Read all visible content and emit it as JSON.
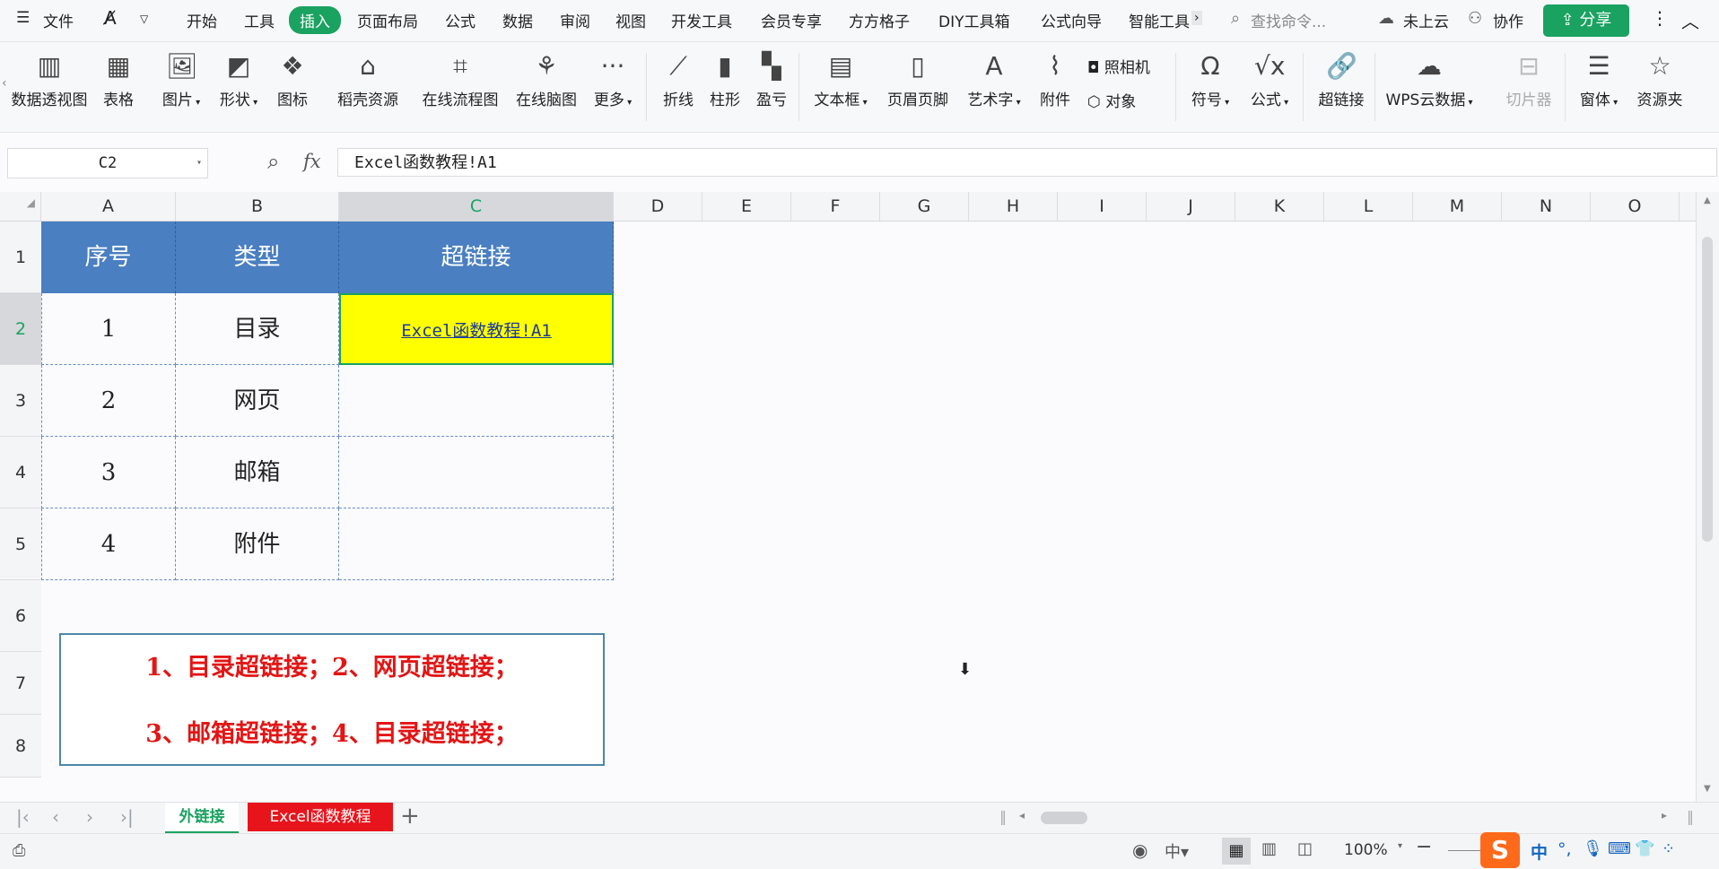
{
  "menubar": {
    "file_label": "文件",
    "tabs": [
      "开始",
      "工具",
      "插入",
      "页面布局",
      "公式",
      "数据",
      "审阅",
      "视图",
      "开发工具",
      "会员专享",
      "方方格子",
      "DIY工具箱",
      "公式向导",
      "智能工具"
    ],
    "search_placeholder": "查找命令...",
    "cloud_label": "未上云",
    "collab_label": "协作",
    "share_label": "分享"
  },
  "ribbon": {
    "items": [
      "数据透视图",
      "表格",
      "图片",
      "形状",
      "图标",
      "稻壳资源",
      "在线流程图",
      "在线脑图",
      "更多",
      "折线",
      "柱形",
      "盈亏",
      "文本框",
      "页眉页脚",
      "艺术字",
      "附件",
      "符号",
      "公式",
      "超链接",
      "WPS云数据",
      "切片器",
      "窗体",
      "资源夹"
    ],
    "camera_label": "照相机",
    "object_label": "对象"
  },
  "formula": {
    "cell_ref": "C2",
    "fx": "fx",
    "value": "Excel函数教程!A1"
  },
  "columns": [
    "A",
    "B",
    "C",
    "D",
    "E",
    "F",
    "G",
    "H",
    "I",
    "J",
    "K",
    "L",
    "M",
    "N",
    "O"
  ],
  "rows": [
    "1",
    "2",
    "3",
    "4",
    "5",
    "6",
    "7",
    "8"
  ],
  "table": {
    "headers": [
      "序号",
      "类型",
      "超链接"
    ],
    "rows": [
      {
        "num": "1",
        "type": "目录",
        "link": "Excel函数教程!A1"
      },
      {
        "num": "2",
        "type": "网页",
        "link": ""
      },
      {
        "num": "3",
        "type": "邮箱",
        "link": ""
      },
      {
        "num": "4",
        "type": "附件",
        "link": ""
      }
    ]
  },
  "note": {
    "line1": "1、目录超链接；2、网页超链接；",
    "line2": "3、邮箱超链接；4、目录超链接；"
  },
  "sheets": {
    "active": "外链接",
    "second": "Excel函数教程",
    "add": "+"
  },
  "status": {
    "zoom": "100%",
    "ime_cn": "中"
  },
  "colors": {
    "accent": "#1aa260",
    "header_fill": "#4a7fc1",
    "selected_fill": "#ffff00",
    "note_text": "#e31515",
    "sheet2_tab": "#e8141c"
  }
}
